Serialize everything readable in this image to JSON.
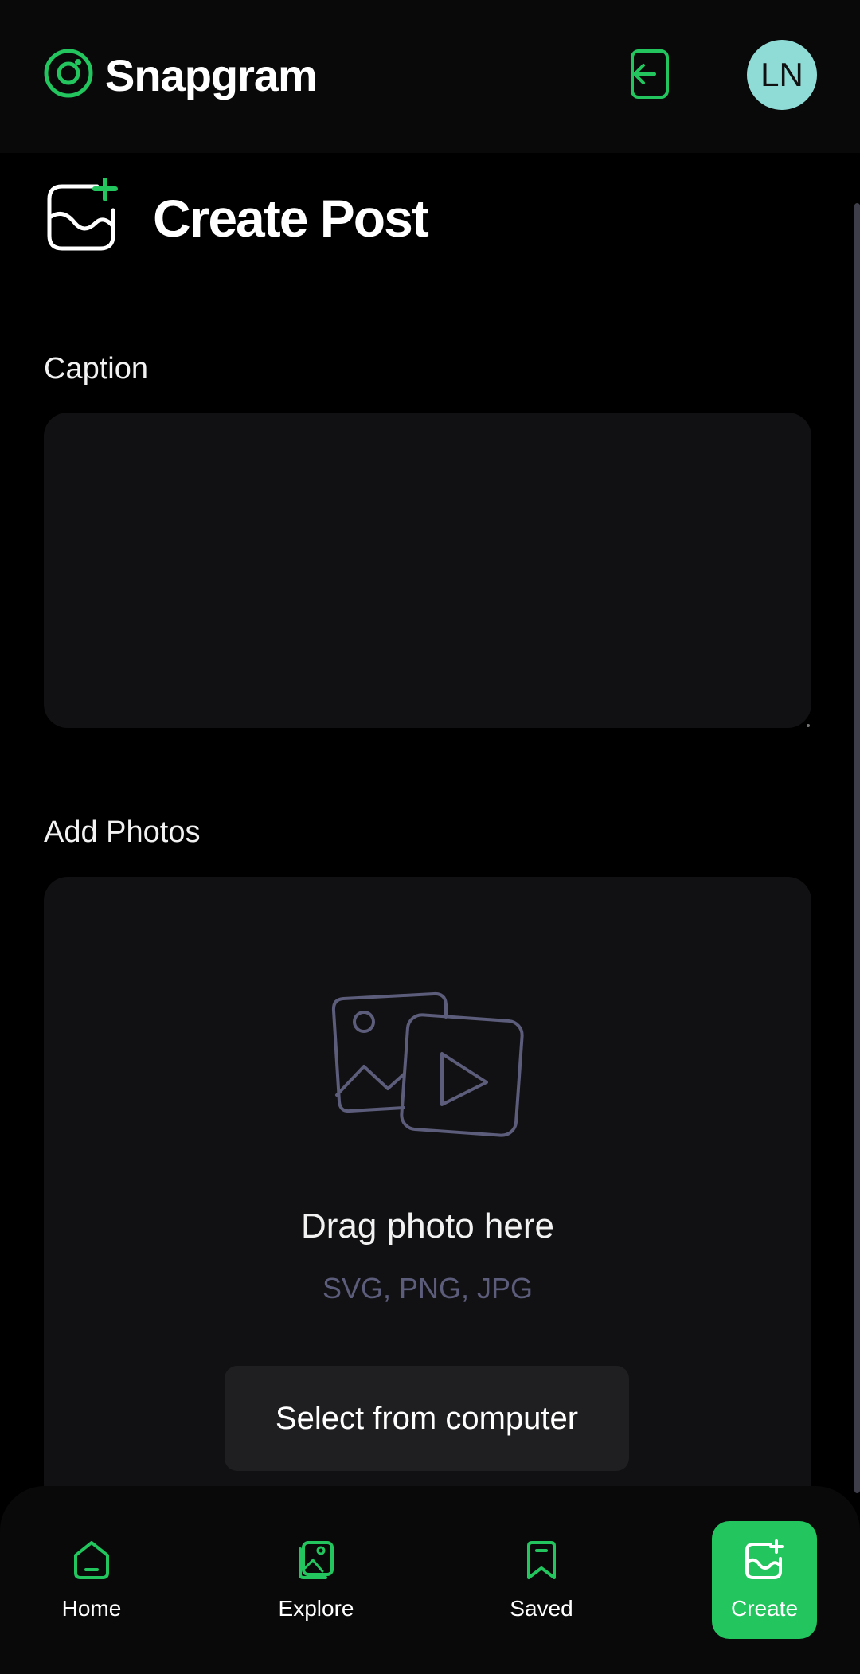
{
  "app": {
    "name": "Snapgram",
    "accent": "#22c55e",
    "avatar_initials": "LN",
    "avatar_color": "#8fdcd7"
  },
  "header": {
    "logo_icon": "snapgram-logo-icon",
    "logout_icon": "logout-icon"
  },
  "page": {
    "title": "Create Post",
    "title_icon": "add-post-icon"
  },
  "form": {
    "caption_label": "Caption",
    "caption_value": "",
    "photos_label": "Add Photos",
    "drag_text": "Drag photo here",
    "formats": "SVG, PNG, JPG",
    "select_button": "Select from computer",
    "upload_icon": "file-upload-icon"
  },
  "nav": {
    "items": [
      {
        "label": "Home",
        "icon": "home-icon",
        "active": false
      },
      {
        "label": "Explore",
        "icon": "explore-icon",
        "active": false
      },
      {
        "label": "Saved",
        "icon": "bookmark-icon",
        "active": false
      },
      {
        "label": "Create",
        "icon": "create-post-icon",
        "active": true
      }
    ]
  }
}
